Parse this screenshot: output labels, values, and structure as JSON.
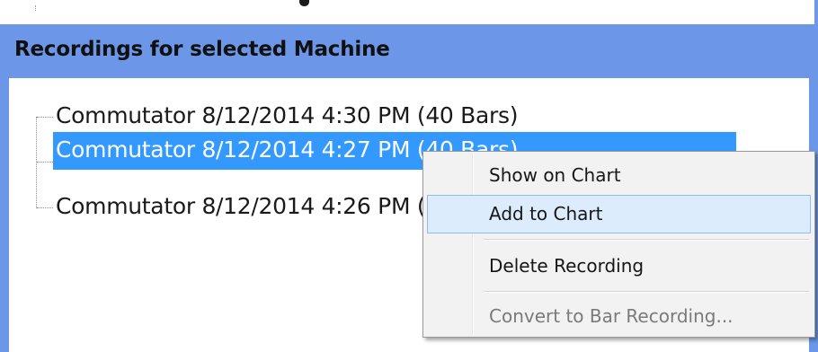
{
  "group": {
    "title": "Recordings for selected Machine"
  },
  "tree": {
    "items": [
      {
        "label": "Commutator 8/12/2014 4:30 PM (40 Bars)",
        "selected": false
      },
      {
        "label": "Commutator 8/12/2014 4:27 PM (40 Bars)",
        "selected": true
      },
      {
        "label": "Commutator 8/12/2014 4:26 PM (40 Bars)",
        "selected": false
      }
    ]
  },
  "context_menu": {
    "items": [
      {
        "label": "Show on Chart",
        "state": "normal"
      },
      {
        "label": "Add to Chart",
        "state": "hover"
      },
      {
        "label": "Delete Recording",
        "state": "normal"
      },
      {
        "label": "Convert to Bar Recording...",
        "state": "disabled"
      }
    ]
  },
  "colors": {
    "frame": "#6c97e8",
    "selection": "#3399ff",
    "menu_background": "#f2f2f2",
    "menu_hover": "#dcecfc",
    "menu_hover_border": "#8cbef0",
    "disabled_text": "#7a7a7a"
  }
}
